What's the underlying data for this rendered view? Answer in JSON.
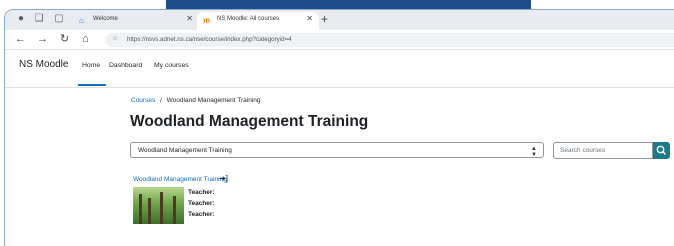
{
  "browser": {
    "tabs": [
      {
        "title": "Welcome",
        "active": false
      },
      {
        "title": "NS Moodle: All courses",
        "active": true
      }
    ],
    "url_host": "https://nsvs.adnet.ns.ca",
    "url_path": "/nse/course/index.php?categoryid=4"
  },
  "navbar": {
    "brand": "NS Moodle",
    "links": [
      "Home",
      "Dashboard",
      "My courses"
    ],
    "active_link": "Home"
  },
  "breadcrumb": {
    "root": "Courses",
    "separator": "/",
    "current": "Woodland Management Training"
  },
  "page": {
    "title": "Woodland Management Training",
    "category_select_value": "Woodland Management Training",
    "search_placeholder": "Search courses"
  },
  "course": {
    "name": "Woodland Management Training",
    "teachers": [
      "Teacher:",
      "Teacher:",
      "Teacher:"
    ]
  },
  "colors": {
    "link": "#0f6cbf",
    "search_button": "#1d7a88",
    "top_accent": "#1f4e8c"
  },
  "icons": [
    "profile-icon",
    "workspaces-icon",
    "tab-actions-icon",
    "welcome-favicon",
    "moodle-favicon",
    "close-icon",
    "new-tab-icon",
    "back-icon",
    "forward-icon",
    "reload-icon",
    "home-icon",
    "lock-icon",
    "dropdown-chevron-icon",
    "search-icon",
    "enrol-icon"
  ]
}
